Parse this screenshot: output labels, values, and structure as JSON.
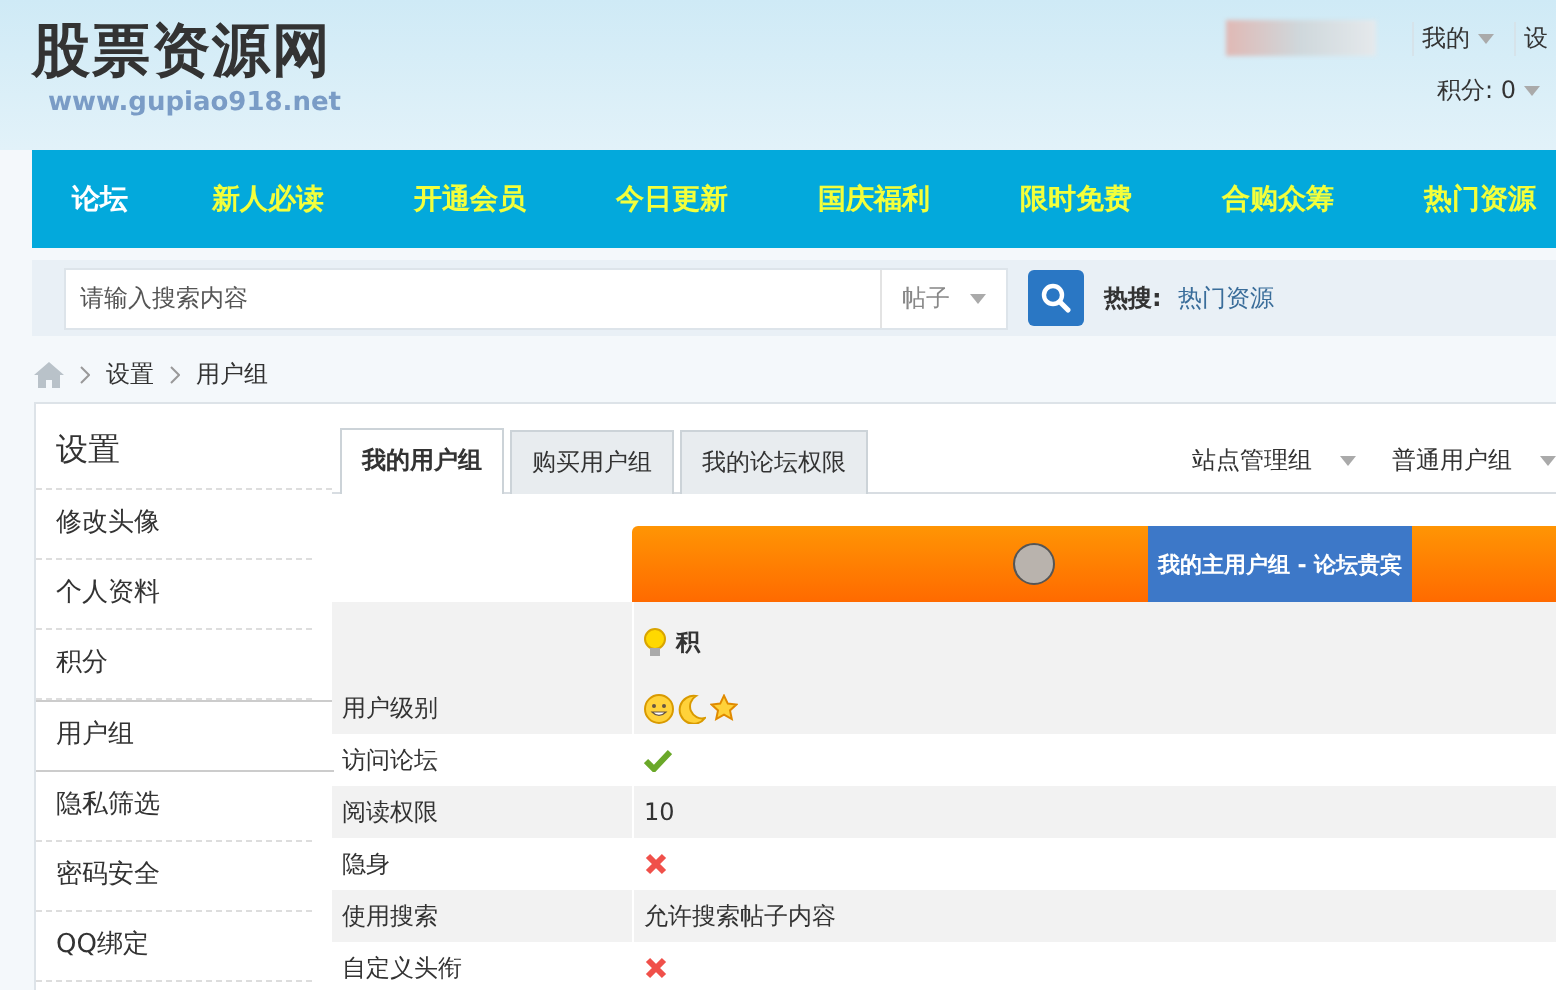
{
  "header": {
    "logo": "股票资源网",
    "url": "www.gupiao918.net",
    "user_menu": [
      {
        "label": "我的",
        "dropdown": true
      },
      {
        "label": "设",
        "dropdown": false
      }
    ],
    "points": "积分: 0"
  },
  "nav": [
    {
      "label": "论坛",
      "selected": true
    },
    {
      "label": "新人必读",
      "selected": false
    },
    {
      "label": "开通会员",
      "selected": false
    },
    {
      "label": "今日更新",
      "selected": false
    },
    {
      "label": "国庆福利",
      "selected": false
    },
    {
      "label": "限时免费",
      "selected": false
    },
    {
      "label": "合购众筹",
      "selected": false
    },
    {
      "label": "热门资源",
      "selected": false
    }
  ],
  "search": {
    "placeholder": "请输入搜索内容",
    "scope": "帖子",
    "hot_label": "热搜:",
    "hot_links": [
      "热门资源"
    ]
  },
  "breadcrumb": [
    "设置",
    "用户组"
  ],
  "sidebar": {
    "title": "设置",
    "items": [
      {
        "label": "修改头像",
        "selected": false
      },
      {
        "label": "个人资料",
        "selected": false
      },
      {
        "label": "积分",
        "selected": false
      },
      {
        "label": "用户组",
        "selected": true
      },
      {
        "label": "隐私筛选",
        "selected": false
      },
      {
        "label": "密码安全",
        "selected": false
      },
      {
        "label": "QQ绑定",
        "selected": false
      }
    ]
  },
  "tabs": [
    {
      "label": "我的用户组",
      "selected": true
    },
    {
      "label": "购买用户组",
      "selected": false
    },
    {
      "label": "我的论坛权限",
      "selected": false
    }
  ],
  "group_menus": [
    "站点管理组",
    "普通用户组"
  ],
  "group_banner": {
    "label": "我的主用户组 - 论坛贵宾"
  },
  "points_row": {
    "label": "积"
  },
  "rows": [
    {
      "label": "用户级别",
      "kind": "rank"
    },
    {
      "label": "访问论坛",
      "kind": "yes"
    },
    {
      "label": "阅读权限",
      "kind": "text",
      "value": "10"
    },
    {
      "label": "隐身",
      "kind": "no"
    },
    {
      "label": "使用搜索",
      "kind": "text",
      "value": "允许搜索帖子内容"
    },
    {
      "label": "自定义头衔",
      "kind": "no"
    }
  ]
}
